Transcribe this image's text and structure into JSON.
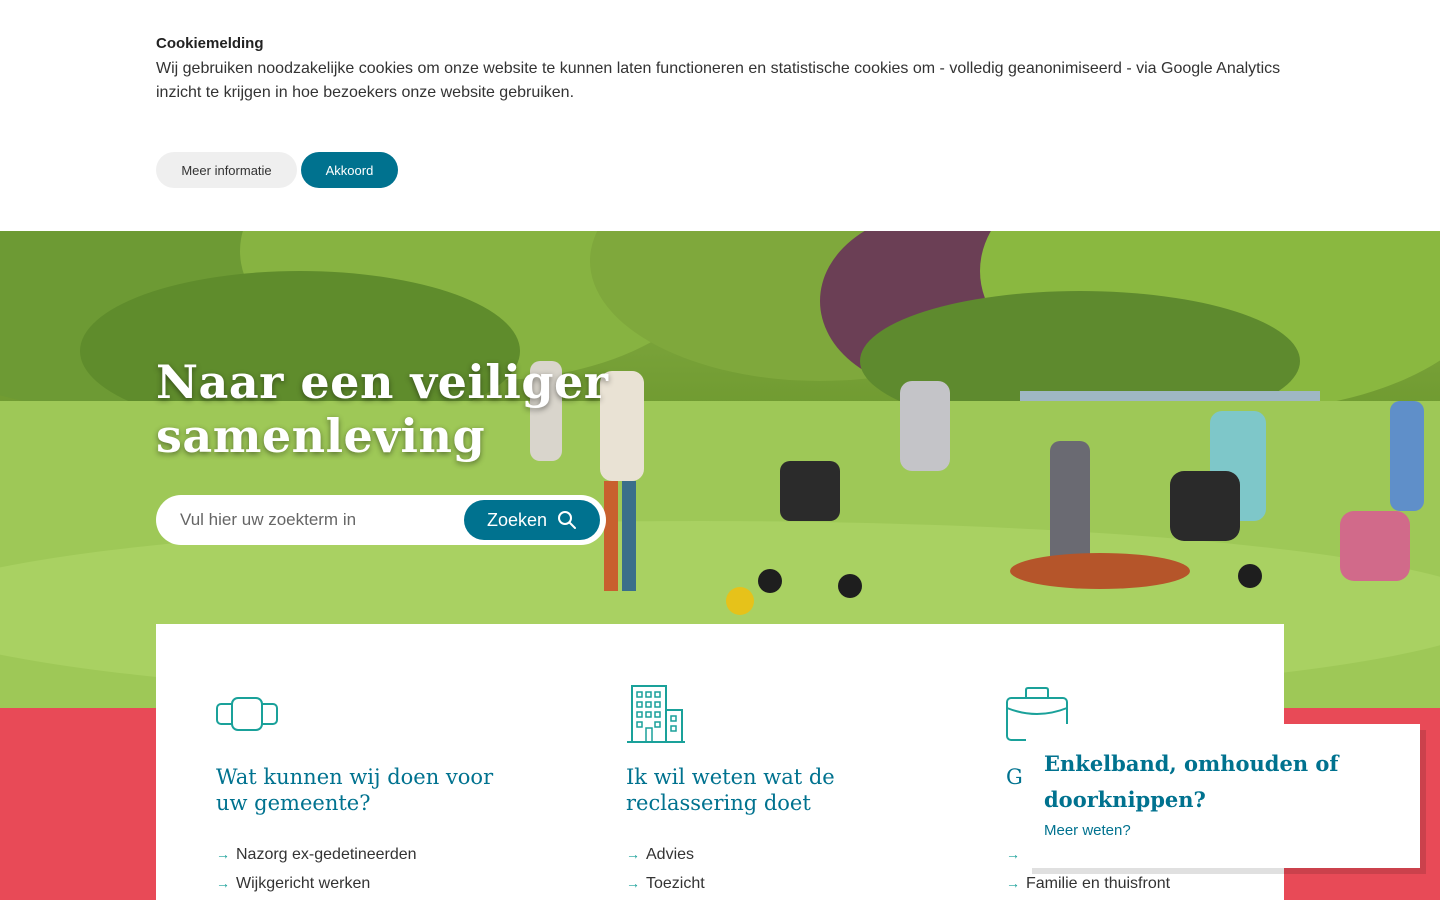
{
  "cookie": {
    "title": "Cookiemelding",
    "text": "Wij gebruiken noodzakelijke cookies om onze website te kunnen laten functioneren en statistische cookies om - volledig geanonimiseerd - via Google Analytics inzicht te krijgen in hoe bezoekers onze website gebruiken.",
    "more_label": "Meer informatie",
    "accept_label": "Akkoord"
  },
  "hero": {
    "title_line1": "Naar een veiliger",
    "title_line2": "samenleving",
    "search": {
      "placeholder": "Vul hier uw zoekterm in",
      "value": "",
      "button_label": "Zoeken"
    }
  },
  "columns": [
    {
      "icon": "ankle-monitor-icon",
      "title": "Wat kunnen wij doen voor uw gemeente?",
      "links": [
        "Nazorg ex-gedetineerden",
        "Wijkgericht werken"
      ]
    },
    {
      "icon": "building-icon",
      "title": "Ik wil weten wat de reclassering doet",
      "links": [
        "Advies",
        "Toezicht"
      ]
    },
    {
      "icon": "briefcase-icon",
      "title": "G h",
      "links": [
        "",
        "Familie en thuisfront"
      ]
    }
  ],
  "popup": {
    "title": "Enkelband, omhouden of doorknippen?",
    "link_label": "Meer weten?"
  },
  "colors": {
    "primary": "#00728f",
    "accent_red": "#e84a57",
    "icon_teal": "#1aa19a"
  }
}
